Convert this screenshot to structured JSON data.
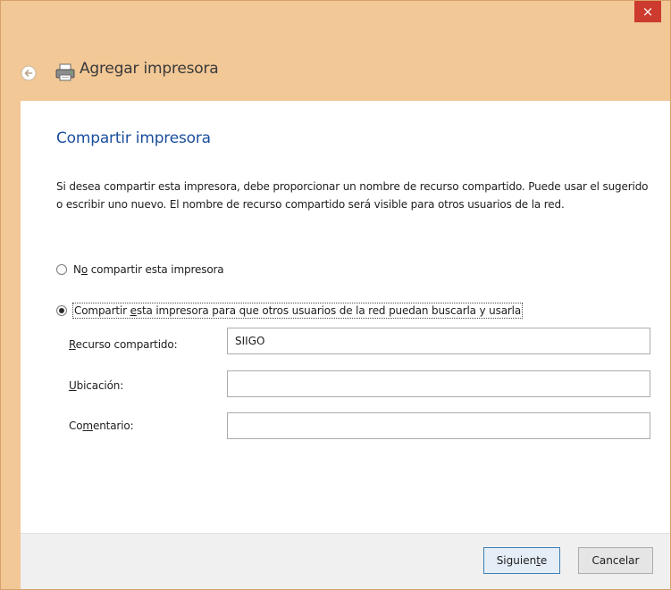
{
  "window": {
    "title": "Agregar impresora",
    "close_glyph": "×"
  },
  "page": {
    "heading": "Compartir impresora",
    "description": "Si desea compartir esta impresora, debe proporcionar un nombre de recurso compartido. Puede usar el sugerido o escribir uno nuevo. El nombre de recurso compartido será visible para otros usuarios de la red."
  },
  "options": {
    "no_share": {
      "pre": "N",
      "accel": "o",
      "post": " compartir esta impresora",
      "selected": false
    },
    "share": {
      "pre": "Compartir ",
      "accel": "e",
      "post": "sta impresora para que otros usuarios de la red puedan buscarla y usarla",
      "selected": true
    }
  },
  "fields": {
    "share_name": {
      "accel": "R",
      "label_rest": "ecurso compartido:",
      "value": "SIIGO"
    },
    "location": {
      "accel": "U",
      "label_rest": "bicación:",
      "value": ""
    },
    "comment": {
      "label_pre": "Co",
      "accel": "m",
      "label_rest": "entario:",
      "value": ""
    }
  },
  "buttons": {
    "next": {
      "pre": "Siguien",
      "accel": "t",
      "post": "e"
    },
    "cancel": "Cancelar"
  },
  "colors": {
    "accent_title": "#1b4f9c",
    "window_frame": "#f2c896",
    "close_button": "#cc3b2e"
  },
  "icons": {
    "back": "back-arrow-icon",
    "printer": "printer-icon",
    "close": "close-icon"
  }
}
